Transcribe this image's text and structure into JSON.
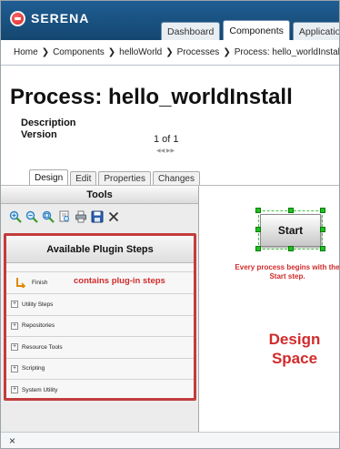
{
  "header": {
    "logo_text": "SERENA",
    "tabs": [
      "Dashboard",
      "Components",
      "Applications"
    ],
    "active_tab": "Components"
  },
  "breadcrumb": [
    "Home",
    "Components",
    "helloWorld",
    "Processes",
    "Process: hello_worldInstall"
  ],
  "page": {
    "title": "Process: hello_worldInstall",
    "description_label": "Description",
    "version_label": "Version",
    "version_value": "1 of 1"
  },
  "subtabs": [
    "Design",
    "Edit",
    "Properties",
    "Changes"
  ],
  "tools": {
    "header": "Tools",
    "icons": [
      "zoom-in-icon",
      "zoom-out-icon",
      "zoom-reset-icon",
      "print-preview-icon",
      "print-icon",
      "save-icon",
      "close-icon"
    ]
  },
  "plugins": {
    "header": "Available Plugin Steps",
    "finish_label": "Finish",
    "finish_note": "contains plug-in steps",
    "groups": [
      "Utility Steps",
      "Repositories",
      "Resource Tools",
      "Scripting",
      "System Utility"
    ]
  },
  "design": {
    "start_label": "Start",
    "start_note": "Every process begins with the Start step.",
    "design_space_label": "Design Space"
  },
  "bottom": {
    "close_glyph": "×"
  },
  "colors": {
    "header_blue": "#1a5488",
    "annotation_red": "#d12b2b",
    "handle_green": "#20c020"
  }
}
